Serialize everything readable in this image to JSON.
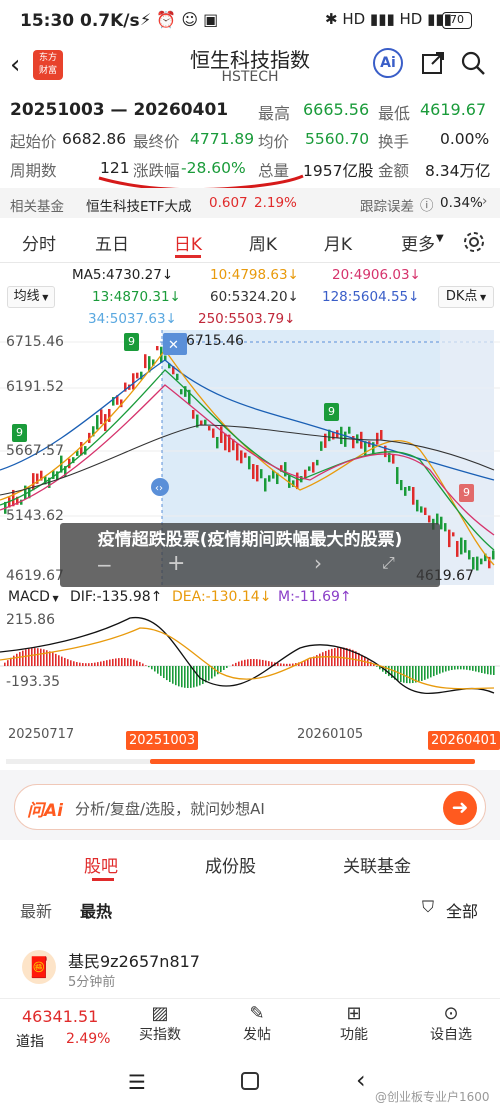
{
  "status": {
    "time": "15:30",
    "speed": "0.7K/s",
    "battery": "70"
  },
  "header": {
    "title": "恒生科技指数",
    "code": "HSTECH",
    "logo_line1": "东方",
    "logo_line2": "财富",
    "ai_label": "Ai"
  },
  "quote": {
    "range": "20251003 — 20260401",
    "high_label": "最高",
    "high": "6665.56",
    "low_label": "最低",
    "low": "4619.67",
    "open_label": "起始价",
    "open": "6682.86",
    "close_label": "最终价",
    "close": "4771.89",
    "avg_label": "均价",
    "avg": "5560.70",
    "turnover_label": "换手",
    "turnover": "0.00%",
    "periods_label": "周期数",
    "periods": "121",
    "change_label": "涨跌幅",
    "change": "-28.60%",
    "volume_label": "总量",
    "volume": "1957亿股",
    "amount_label": "金额",
    "amount": "8.34万亿"
  },
  "fund": {
    "label": "相关基金",
    "name": "恒生科技ETF大成",
    "price": "0.607",
    "pct": "2.19%",
    "err_label": "跟踪误差",
    "err": "0.34%"
  },
  "tabs": [
    "分时",
    "五日",
    "日K",
    "周K",
    "月K",
    "更多"
  ],
  "active_tab": "日K",
  "ma": {
    "selector": "均线",
    "ma5": "MA5:4730.27↓",
    "ma10": "10:4798.63↓",
    "ma20": "20:4906.03↓",
    "ma13": "13:4870.31↓",
    "ma60": "60:5324.20↓",
    "ma128": "128:5604.55↓",
    "ma34": "34:5037.63↓",
    "ma250": "250:5503.79↓",
    "dk": "DK点"
  },
  "yaxis": [
    "6715.46",
    "6191.52",
    "5667.57",
    "5143.62",
    "4619.67"
  ],
  "peak_label": "6715.46",
  "low_label": "4619.67",
  "overlay_text": "疫情超跌股票(疫情期间跌幅最大的股票)",
  "macd": {
    "name": "MACD",
    "dif": "DIF:-135.98↑",
    "dea": "DEA:-130.14↓",
    "m": "M:-11.69↑",
    "top": "215.86",
    "bottom": "-193.35"
  },
  "dates": {
    "left": "20250717",
    "mid": "20260105",
    "start": "20251003",
    "end": "20260401"
  },
  "ai": {
    "brand": "问Ai",
    "placeholder": "分析/复盘/选股，就问妙想AI"
  },
  "content_tabs": [
    "股吧",
    "成份股",
    "关联基金"
  ],
  "sort": {
    "latest": "最新",
    "hot": "最热",
    "filter": "全部"
  },
  "post": {
    "user": "基民9z2657n817",
    "time": "5分钟前"
  },
  "bottom": {
    "index": "46341.51",
    "index_name": "道指",
    "index_pct": "2.49%",
    "buy": "买指数",
    "post": "发帖",
    "func": "功能",
    "settings": "设自选"
  },
  "watermark": "@创业板专业户1600",
  "colors": {
    "red": "#e02b2b",
    "green": "#1a9b3a",
    "accent": "#ff5a1f",
    "blue": "#3a5ec8"
  }
}
